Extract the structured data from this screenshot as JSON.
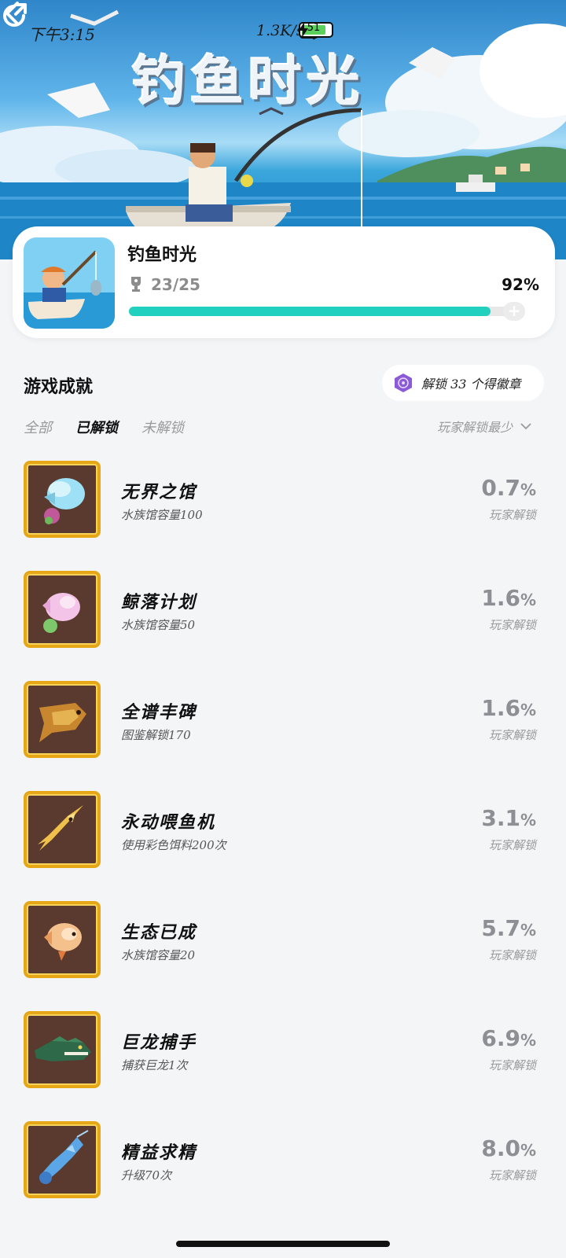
{
  "status_bar": {
    "time": "下午3:15",
    "speed": "1.3K/s",
    "battery": "51"
  },
  "hero": {
    "title": "钓鱼时光",
    "icons": [
      "back-arrow-icon",
      "share-icon"
    ]
  },
  "game_card": {
    "name": "钓鱼时光",
    "progress_text": "23/25",
    "progress_percent": "92%",
    "progress_value": 0.92
  },
  "section": {
    "title": "游戏成就",
    "badge_text": "解锁 33 个得徽章"
  },
  "tabs": [
    {
      "label": "全部",
      "active": false
    },
    {
      "label": "已解锁",
      "active": true
    },
    {
      "label": "未解锁",
      "active": false
    }
  ],
  "sort": {
    "label": "玩家解锁最少"
  },
  "achievements": [
    {
      "name": "无界之馆",
      "desc": "水族馆容量100",
      "rate": "0.7",
      "rate_unit": "%",
      "rate_label": "玩家解锁",
      "icon": "crystal-fish-icon"
    },
    {
      "name": "鲸落计划",
      "desc": "水族馆容量50",
      "rate": "1.6",
      "rate_unit": "%",
      "rate_label": "玩家解锁",
      "icon": "pink-fish-icon"
    },
    {
      "name": "全谱丰碑",
      "desc": "图鉴解锁170",
      "rate": "1.6",
      "rate_unit": "%",
      "rate_label": "玩家解锁",
      "icon": "golden-fish-icon"
    },
    {
      "name": "永动喂鱼机",
      "desc": "使用彩色饵料200次",
      "rate": "3.1",
      "rate_unit": "%",
      "rate_label": "玩家解锁",
      "icon": "gold-swordfish-icon"
    },
    {
      "name": "生态已成",
      "desc": "水族馆容量20",
      "rate": "5.7",
      "rate_unit": "%",
      "rate_label": "玩家解锁",
      "icon": "orange-fish-icon"
    },
    {
      "name": "巨龙捕手",
      "desc": "捕获巨龙1次",
      "rate": "6.9",
      "rate_unit": "%",
      "rate_label": "玩家解锁",
      "icon": "crocodile-icon"
    },
    {
      "name": "精益求精",
      "desc": "升级70次",
      "rate": "8.0",
      "rate_unit": "%",
      "rate_label": "玩家解锁",
      "icon": "blue-lobster-icon"
    }
  ]
}
